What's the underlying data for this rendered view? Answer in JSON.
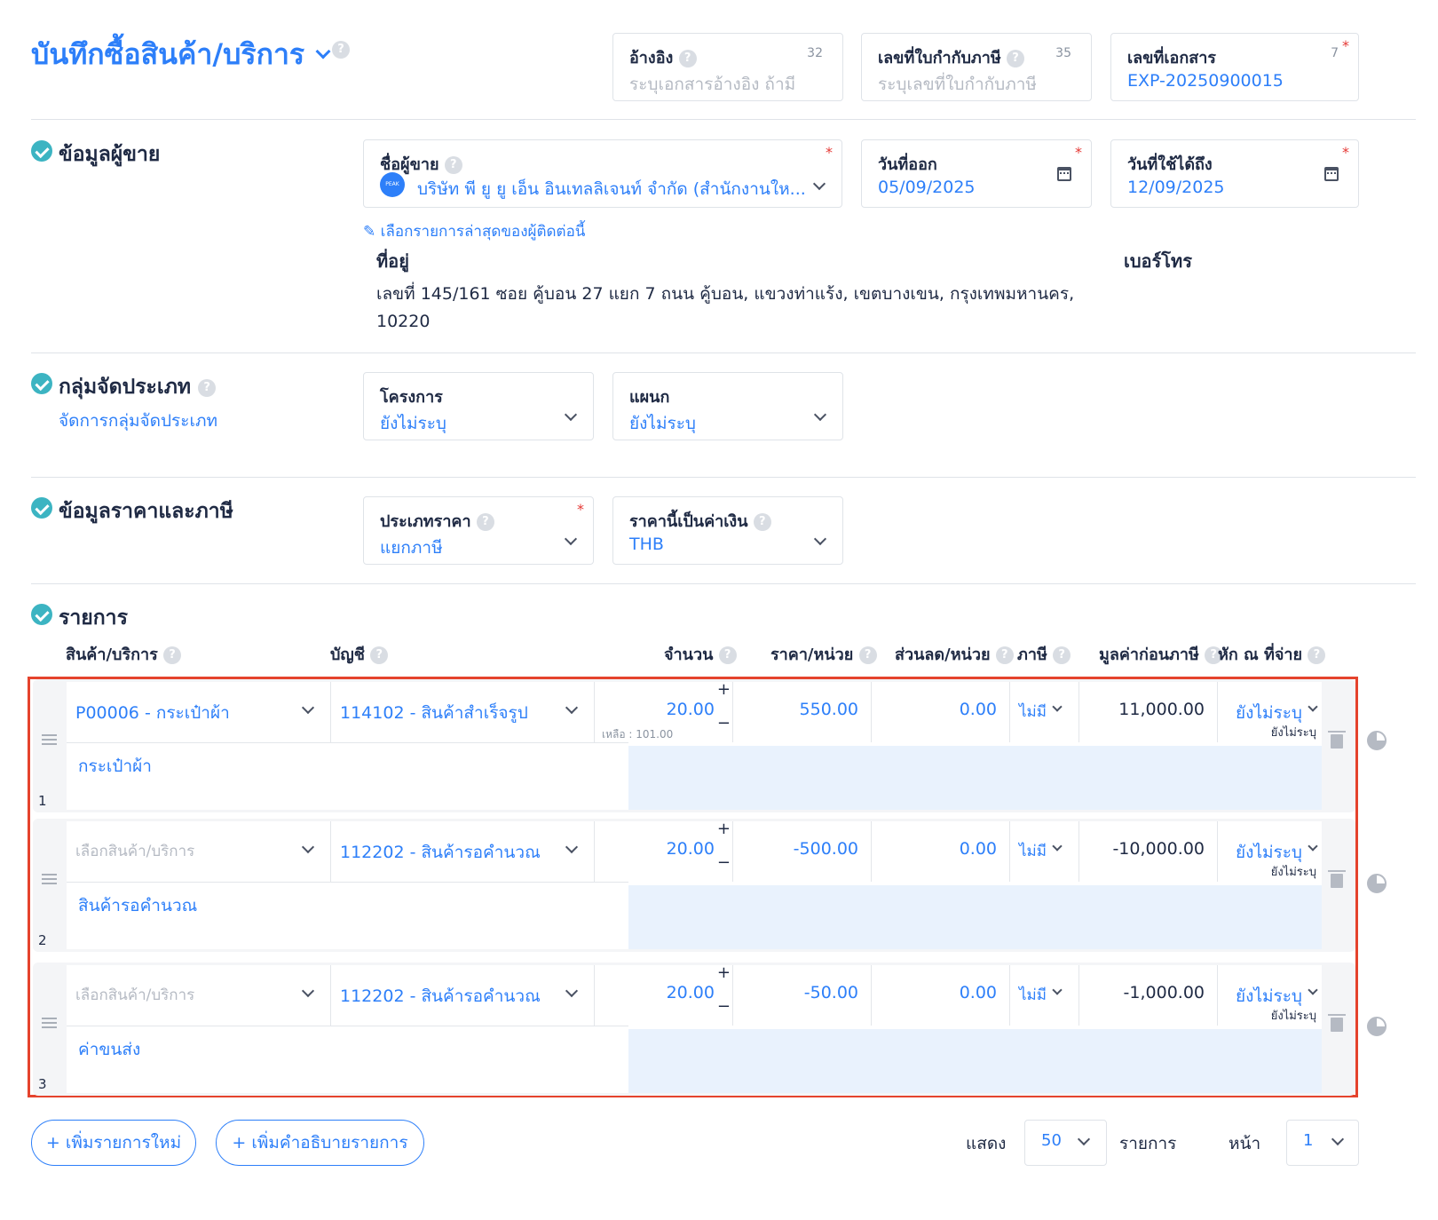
{
  "header": {
    "title": "บันทึกซื้อสินค้า/บริการ",
    "reference": {
      "label": "อ้างอิง",
      "counter": "32",
      "placeholder": "ระบุเอกสารอ้างอิง ถ้ามี"
    },
    "tax_invoice": {
      "label": "เลขที่ใบกำกับภาษี",
      "counter": "35",
      "placeholder": "ระบุเลขที่ใบกำกับภาษี"
    },
    "doc_number": {
      "label": "เลขที่เอกสาร",
      "counter": "7",
      "value": "EXP-20250900015"
    }
  },
  "vendor": {
    "section_title": "ข้อมูลผู้ขาย",
    "name_label": "ชื่อผู้ขาย",
    "logo_text": "PEAK",
    "name_value": "บริษัท พี ยู ยู เอ็น อินเทลลิเจนท์ จำกัด (สำนักงานให...",
    "issue_date_label": "วันที่ออก",
    "issue_date": "05/09/2025",
    "valid_date_label": "วันที่ใช้ได้ถึง",
    "valid_date": "12/09/2025",
    "recent_link": "เลือกรายการล่าสุดของผู้ติดต่อนี้",
    "address_label": "ที่อยู่",
    "address_line1": "เลขที่ 145/161 ซอย คู้บอน 27 แยก 7 ถนน คู้บอน, แขวงท่าแร้ง, เขตบางเขน, กรุงเทพมหานคร,",
    "address_line2": "10220",
    "phone_label": "เบอร์โทร"
  },
  "classification": {
    "section_title": "กลุ่มจัดประเภท",
    "manage_link": "จัดการกลุ่มจัดประเภท",
    "project_label": "โครงการ",
    "project_value": "ยังไม่ระบุ",
    "department_label": "แผนก",
    "department_value": "ยังไม่ระบุ"
  },
  "pricing": {
    "section_title": "ข้อมูลราคาและภาษี",
    "price_type_label": "ประเภทราคา",
    "price_type_value": "แยกภาษี",
    "currency_label": "ราคานี้เป็นค่าเงิน",
    "currency_value": "THB"
  },
  "items": {
    "section_title": "รายการ",
    "columns": {
      "product": "สินค้า/บริการ",
      "account": "บัญชี",
      "qty": "จำนวน",
      "price": "ราคา/หน่วย",
      "discount": "ส่วนลด/หน่วย",
      "tax": "ภาษี",
      "pretax": "มูลค่าก่อนภาษี",
      "wht": "หัก ณ ที่จ่าย"
    },
    "rows": [
      {
        "num": "1",
        "product": "P00006 - กระเป๋าผ้า",
        "account": "114102 - สินค้าสำเร็จรูป",
        "qty": "20.00",
        "remaining": "เหลือ : 101.00",
        "price": "550.00",
        "discount": "0.00",
        "tax": "ไม่มี",
        "pretax": "11,000.00",
        "wht": "ยังไม่ระบุ",
        "wht_sub": "ยังไม่ระบุ",
        "description": "กระเป๋าผ้า"
      },
      {
        "num": "2",
        "product": "เลือกสินค้า/บริการ",
        "account": "112202 - สินค้ารอคำนวณ",
        "qty": "20.00",
        "remaining": "",
        "price": "-500.00",
        "discount": "0.00",
        "tax": "ไม่มี",
        "pretax": "-10,000.00",
        "wht": "ยังไม่ระบุ",
        "wht_sub": "ยังไม่ระบุ",
        "description": "สินค้ารอคำนวณ"
      },
      {
        "num": "3",
        "product": "เลือกสินค้า/บริการ",
        "account": "112202 - สินค้ารอคำนวณ",
        "qty": "20.00",
        "remaining": "",
        "price": "-50.00",
        "discount": "0.00",
        "tax": "ไม่มี",
        "pretax": "-1,000.00",
        "wht": "ยังไม่ระบุ",
        "wht_sub": "ยังไม่ระบุ",
        "description": "ค่าขนส่ง"
      }
    ]
  },
  "footer": {
    "add_item": "+ เพิ่มรายการใหม่",
    "add_description": "+ เพิ่มคำอธิบายรายการ",
    "show_label": "แสดง",
    "page_size": "50",
    "items_label": "รายการ",
    "page_label": "หน้า",
    "page_number": "1"
  },
  "colors": {
    "accent": "#2d7ff9",
    "highlight_border": "#e5432d",
    "check": "#3cb4c2"
  }
}
